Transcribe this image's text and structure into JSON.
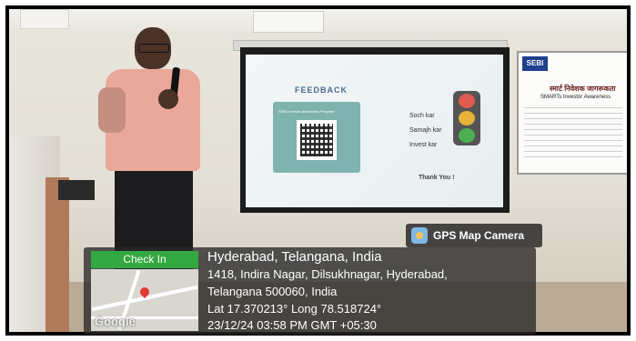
{
  "slide": {
    "title": "FEEDBACK",
    "card_heading": "SEBI Investor Awareness Program",
    "lines": [
      "Soch kar",
      "Samajh kar",
      "Invest kar"
    ],
    "thanks": "Thank You !",
    "traffic_light_colors": [
      "#e05a4f",
      "#e7b33c",
      "#4caf50"
    ]
  },
  "poster": {
    "logo": "SEBI",
    "title_hindi": "स्मार्ट निवेशक जागरूकता",
    "subtitle": "SMARTs Investor Awareness"
  },
  "gps": {
    "badge": "GPS Map Camera",
    "check_in": "Check In",
    "map_watermark": "Google",
    "location_title": "Hyderabad, Telangana, India",
    "address_line1": "1418, Indira Nagar, Dilsukhnagar, Hyderabad,",
    "address_line2": "Telangana 500060, India",
    "coordinates": "Lat 17.370213° Long 78.518724°",
    "timestamp": "23/12/24 03:58 PM GMT +05:30"
  },
  "colors": {
    "check_in_green": "#33a840",
    "overlay_dark": "#282828"
  }
}
